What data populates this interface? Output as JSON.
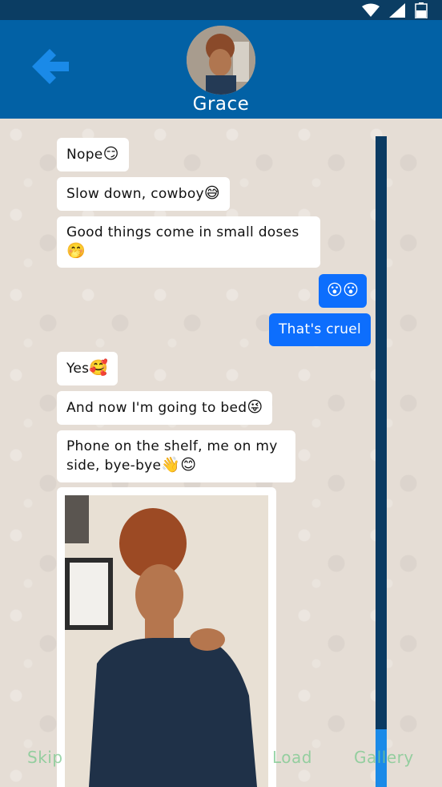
{
  "header": {
    "contact_name": "Grace"
  },
  "messages": [
    {
      "direction": "received",
      "text": "Nope",
      "emoji": "😏"
    },
    {
      "direction": "received",
      "text": "Slow down, cowboy",
      "emoji": "😅"
    },
    {
      "direction": "received",
      "text_line1": "Good things come in small doses",
      "emoji": "🤭"
    },
    {
      "direction": "sent",
      "emoji": "😮😮"
    },
    {
      "direction": "sent",
      "text": "That's cruel"
    },
    {
      "direction": "received",
      "text": "Yes",
      "emoji": "🥰"
    },
    {
      "direction": "received",
      "text": "And now I'm going to bed",
      "emoji": "😜"
    },
    {
      "direction": "received",
      "text_line1": "Phone on the shelf, me on my",
      "text_line2": "side, bye-bye",
      "emoji": "👋😊"
    }
  ],
  "menu": {
    "skip": "Skip",
    "load": "Load",
    "gallery": "Gallery"
  },
  "colors": {
    "header": "#0261a5",
    "status_bar": "#0b3d63",
    "sent_bubble": "#0d6efd",
    "received_bubble": "#ffffff",
    "back_arrow": "#1a8ae8"
  },
  "icons": [
    "wifi-icon",
    "cell-signal-icon",
    "battery-icon",
    "back-arrow-icon"
  ]
}
